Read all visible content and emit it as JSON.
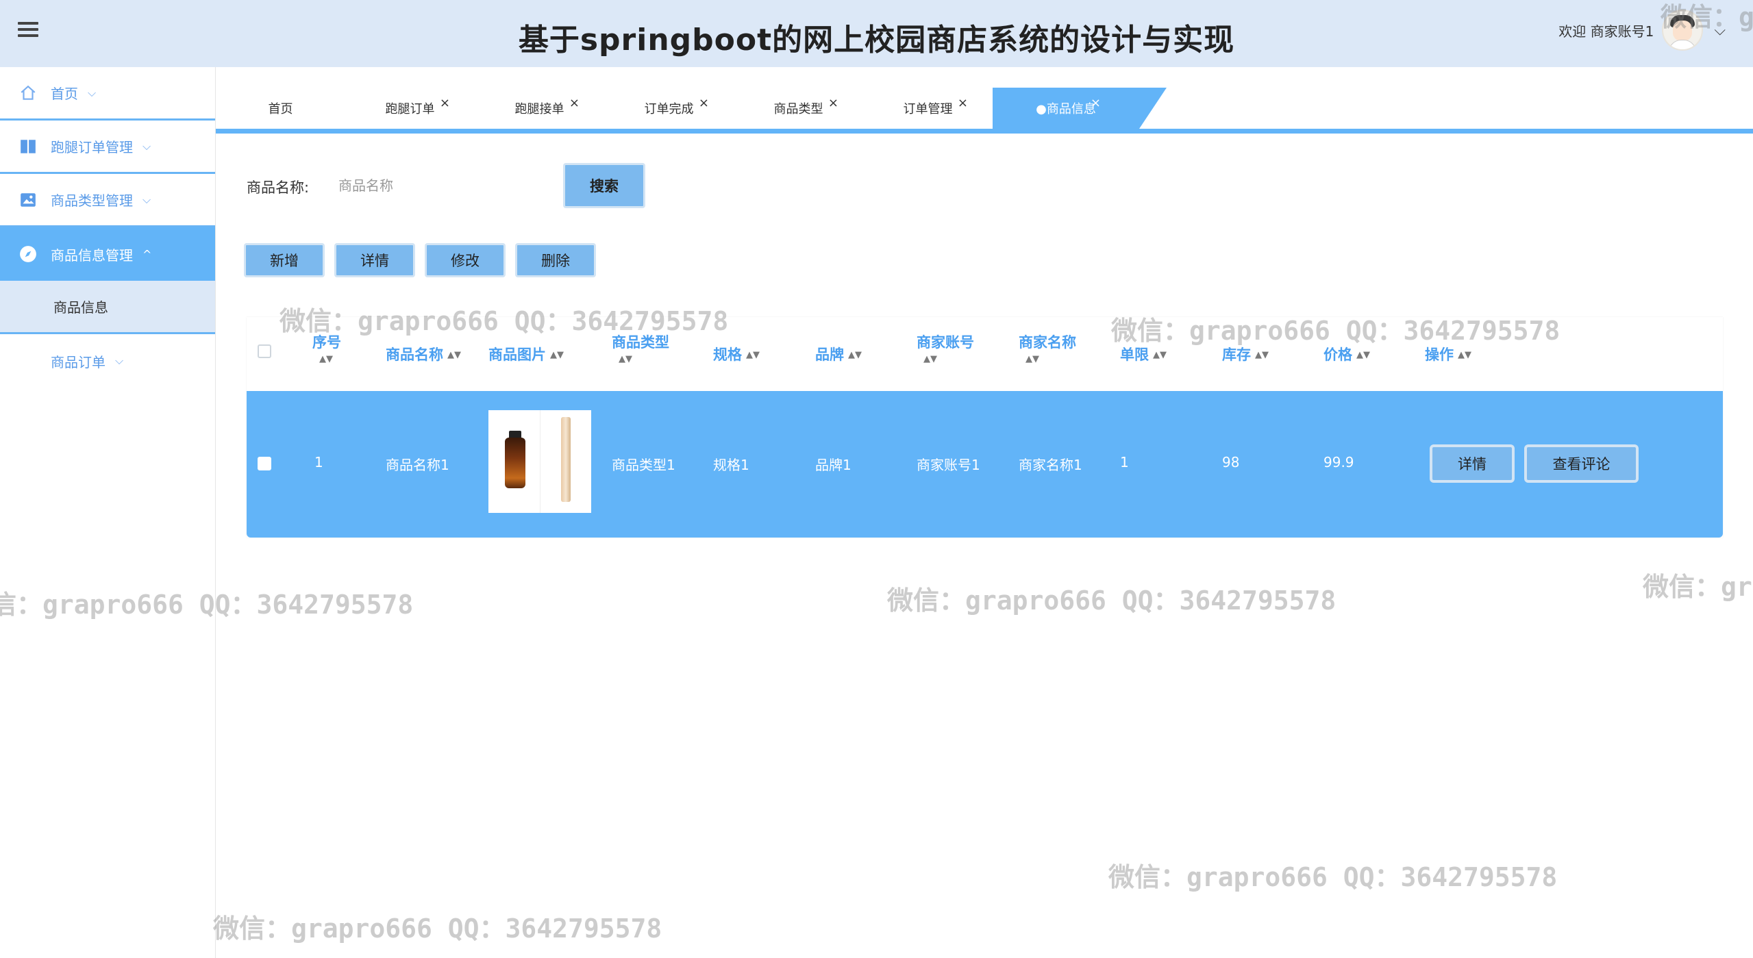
{
  "header": {
    "title": "基于springboot的网上校园商店系统的设计与实现",
    "welcome": "欢迎 商家账号1",
    "menu_icon": "hamburger-icon",
    "chevron_icon": "chevron-down-icon"
  },
  "sidebar": {
    "items": [
      {
        "label": "首页",
        "icon": "home-icon"
      },
      {
        "label": "跑腿订单管理",
        "icon": "book-icon"
      },
      {
        "label": "商品类型管理",
        "icon": "image-icon"
      },
      {
        "label": "商品信息管理",
        "icon": "compass-icon"
      },
      {
        "label": "商品信息"
      },
      {
        "label": "商品订单"
      }
    ]
  },
  "tabs": [
    {
      "label": "首页"
    },
    {
      "label": "跑腿订单"
    },
    {
      "label": "跑腿接单"
    },
    {
      "label": "订单完成"
    },
    {
      "label": "商品类型"
    },
    {
      "label": "订单管理"
    },
    {
      "label": "●商品信息"
    }
  ],
  "tab_close": "×",
  "search": {
    "label": "商品名称:",
    "placeholder": "商品名称",
    "button": "搜索"
  },
  "actions": {
    "add": "新增",
    "detail": "详情",
    "edit": "修改",
    "delete": "删除"
  },
  "table": {
    "headers": {
      "index": "序号",
      "name": "商品名称",
      "image": "商品图片",
      "type": "商品类型",
      "spec": "规格",
      "brand": "品牌",
      "merchant_account": "商家账号",
      "merchant_name": "商家名称",
      "limit": "单限",
      "stock": "库存",
      "price": "价格",
      "ops": "操作"
    },
    "rows": [
      {
        "index": "1",
        "name": "商品名称1",
        "type": "商品类型1",
        "spec": "规格1",
        "brand": "品牌1",
        "merchant_account": "商家账号1",
        "merchant_name": "商家名称1",
        "limit": "1",
        "stock": "98",
        "price": "99.9",
        "detail_btn": "详情",
        "review_btn": "查看评论"
      }
    ]
  },
  "sort_glyph": "▲▼",
  "watermark": "微信：grapro666 QQ：3642795578",
  "watermark_partial_1": "微信：g",
  "watermark_partial_2": "微信：gr",
  "watermark_left": "信：grapro666 QQ：3642795578",
  "colors": {
    "header_bg": "#dce8f7",
    "accent": "#62b4f8",
    "button": "#7cb9ee",
    "link": "#4a9ff0"
  }
}
